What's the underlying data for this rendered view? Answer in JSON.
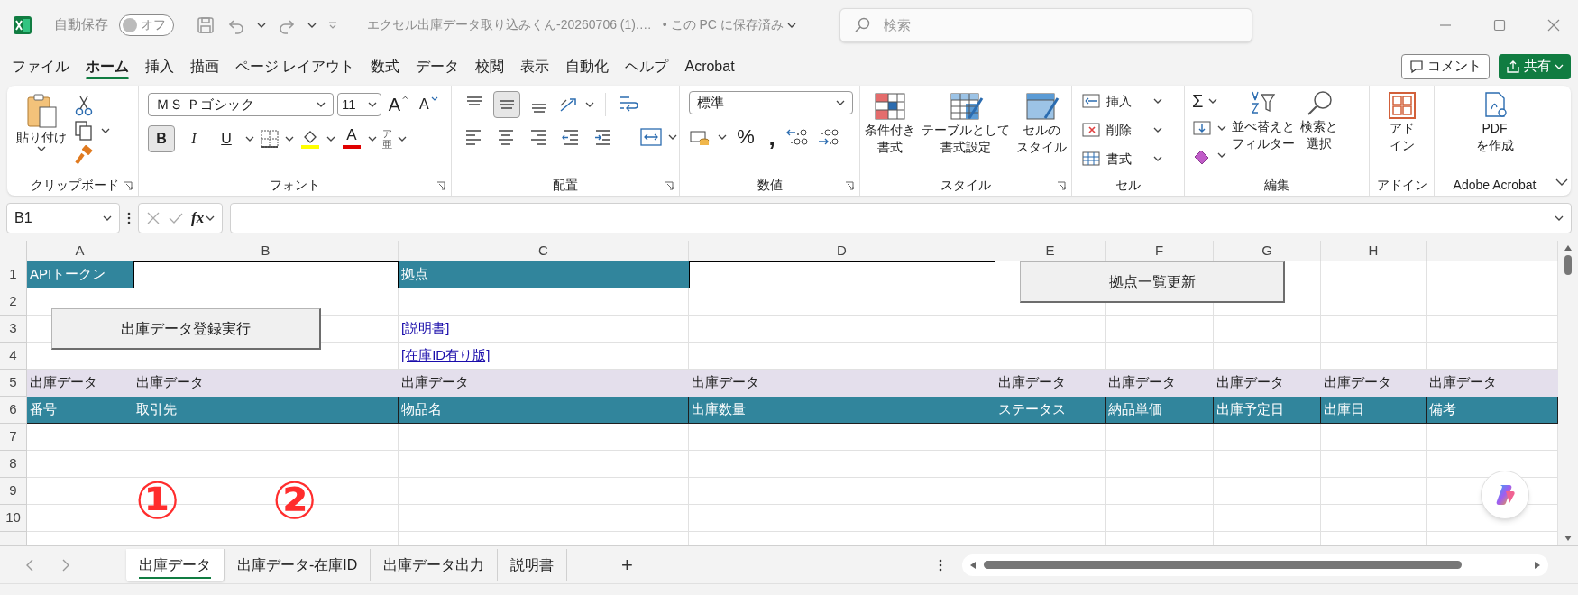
{
  "title_bar": {
    "autosave": {
      "label": "自動保存",
      "on": false,
      "state_label": "オフ"
    },
    "document_title": "エクセル出庫データ取り込みくん-20260706 (1).…",
    "save_status": "• この PC に保存済み",
    "search": {
      "placeholder": "検索"
    }
  },
  "menu_tabs": [
    {
      "label": "ファイル",
      "selected": false
    },
    {
      "label": "ホーム",
      "selected": true
    },
    {
      "label": "挿入",
      "selected": false
    },
    {
      "label": "描画",
      "selected": false
    },
    {
      "label": "ページ レイアウト",
      "selected": false
    },
    {
      "label": "数式",
      "selected": false
    },
    {
      "label": "データ",
      "selected": false
    },
    {
      "label": "校閲",
      "selected": false
    },
    {
      "label": "表示",
      "selected": false
    },
    {
      "label": "自動化",
      "selected": false
    },
    {
      "label": "ヘルプ",
      "selected": false
    },
    {
      "label": "Acrobat",
      "selected": false
    }
  ],
  "menu_actions": {
    "comment": "コメント",
    "share": "共有"
  },
  "ribbon": {
    "clipboard": {
      "label": "クリップボード",
      "paste": "貼り付け"
    },
    "font": {
      "label": "フォント",
      "font_name": "ＭＳ Ｐゴシック",
      "font_size": "11",
      "grow": "A",
      "shrink": "A",
      "toggles": [
        {
          "kind": "bold",
          "label": "B",
          "on": true
        },
        {
          "kind": "italic",
          "label": "I",
          "on": false
        },
        {
          "kind": "underline",
          "label": "U",
          "on": false
        }
      ],
      "font_color": "A",
      "phonetic": "ア亜"
    },
    "alignment": {
      "label": "配置",
      "vertical": [
        {
          "kind": "top",
          "on": false
        },
        {
          "kind": "middle",
          "on": true
        },
        {
          "kind": "bottom",
          "on": false
        }
      ]
    },
    "number": {
      "label": "数値",
      "format": "標準",
      "percent": "%",
      "comma": ","
    },
    "styles": {
      "label": "スタイル",
      "buttons": [
        {
          "kind": "conditional",
          "lines": [
            "条件付き",
            "書式"
          ]
        },
        {
          "kind": "table",
          "lines": [
            "テーブルとして",
            "書式設定"
          ]
        },
        {
          "kind": "cell",
          "lines": [
            "セルの",
            "スタイル"
          ]
        }
      ]
    },
    "cells": {
      "label": "セル",
      "buttons": [
        {
          "kind": "insert",
          "label": "挿入"
        },
        {
          "kind": "delete",
          "label": "削除"
        },
        {
          "kind": "format",
          "label": "書式"
        }
      ]
    },
    "editing": {
      "label": "編集",
      "sum": "Σ",
      "buttons": [
        {
          "kind": "sort",
          "lines": [
            "並べ替えと",
            "フィルター"
          ]
        },
        {
          "kind": "find",
          "lines": [
            "検索と",
            "選択"
          ]
        }
      ]
    },
    "addins": {
      "label": "アドイン",
      "lines": [
        "アド",
        "イン"
      ]
    },
    "acrobat": {
      "label": "Adobe Acrobat",
      "lines": [
        "PDF",
        "を作成"
      ]
    }
  },
  "formula_bar": {
    "name_box": "B1",
    "function_label": "fx"
  },
  "sheet": {
    "columns": [
      "A",
      "B",
      "C",
      "D",
      "E",
      "F",
      "G",
      "H"
    ],
    "rows": [
      {
        "number": "1",
        "cells": [
          {
            "kind": "header",
            "text": "APIトークン"
          },
          {
            "kind": "input"
          },
          {
            "kind": "header",
            "text": "拠点"
          },
          {
            "kind": "input"
          }
        ]
      },
      {
        "number": "2"
      },
      {
        "number": "3",
        "cells": [
          {
            "kind": "empty"
          },
          {
            "kind": "empty"
          },
          {
            "kind": "link",
            "text": "[説明書]"
          }
        ]
      },
      {
        "number": "4",
        "cells": [
          {
            "kind": "empty"
          },
          {
            "kind": "empty"
          },
          {
            "kind": "link",
            "text": "[在庫ID有り版]"
          }
        ]
      },
      {
        "number": "5",
        "cells": [
          {
            "kind": "band",
            "text": "出庫データ"
          },
          {
            "kind": "band",
            "text": "出庫データ"
          },
          {
            "kind": "band",
            "text": "出庫データ"
          },
          {
            "kind": "band",
            "text": "出庫データ"
          },
          {
            "kind": "band",
            "text": "出庫データ"
          },
          {
            "kind": "band",
            "text": "出庫データ"
          },
          {
            "kind": "band",
            "text": "出庫データ"
          },
          {
            "kind": "band",
            "text": "出庫データ"
          },
          {
            "kind": "band",
            "text": "出庫データ"
          }
        ]
      },
      {
        "number": "6",
        "cells": [
          {
            "kind": "column",
            "text": "番号"
          },
          {
            "kind": "column",
            "text": "取引先"
          },
          {
            "kind": "column",
            "text": "物品名"
          },
          {
            "kind": "column",
            "text": "出庫数量"
          },
          {
            "kind": "column",
            "text": "ステータス"
          },
          {
            "kind": "column",
            "text": "納品単価"
          },
          {
            "kind": "column",
            "text": "出庫予定日"
          },
          {
            "kind": "column",
            "text": "出庫日"
          },
          {
            "kind": "column",
            "text": "備考"
          }
        ]
      },
      {
        "number": "7"
      },
      {
        "number": "8"
      },
      {
        "number": "9"
      },
      {
        "number": "10"
      }
    ],
    "buttons": [
      {
        "label": "出庫データ登録実行"
      },
      {
        "label": "拠点一覧更新"
      }
    ],
    "annotations": [
      "①",
      "②"
    ]
  },
  "sheet_tabs": [
    {
      "label": "出庫データ",
      "selected": true
    },
    {
      "label": "出庫データ-在庫ID",
      "selected": false
    },
    {
      "label": "出庫データ出力",
      "selected": false
    },
    {
      "label": "説明書",
      "selected": false
    }
  ],
  "add_sheet": "+"
}
